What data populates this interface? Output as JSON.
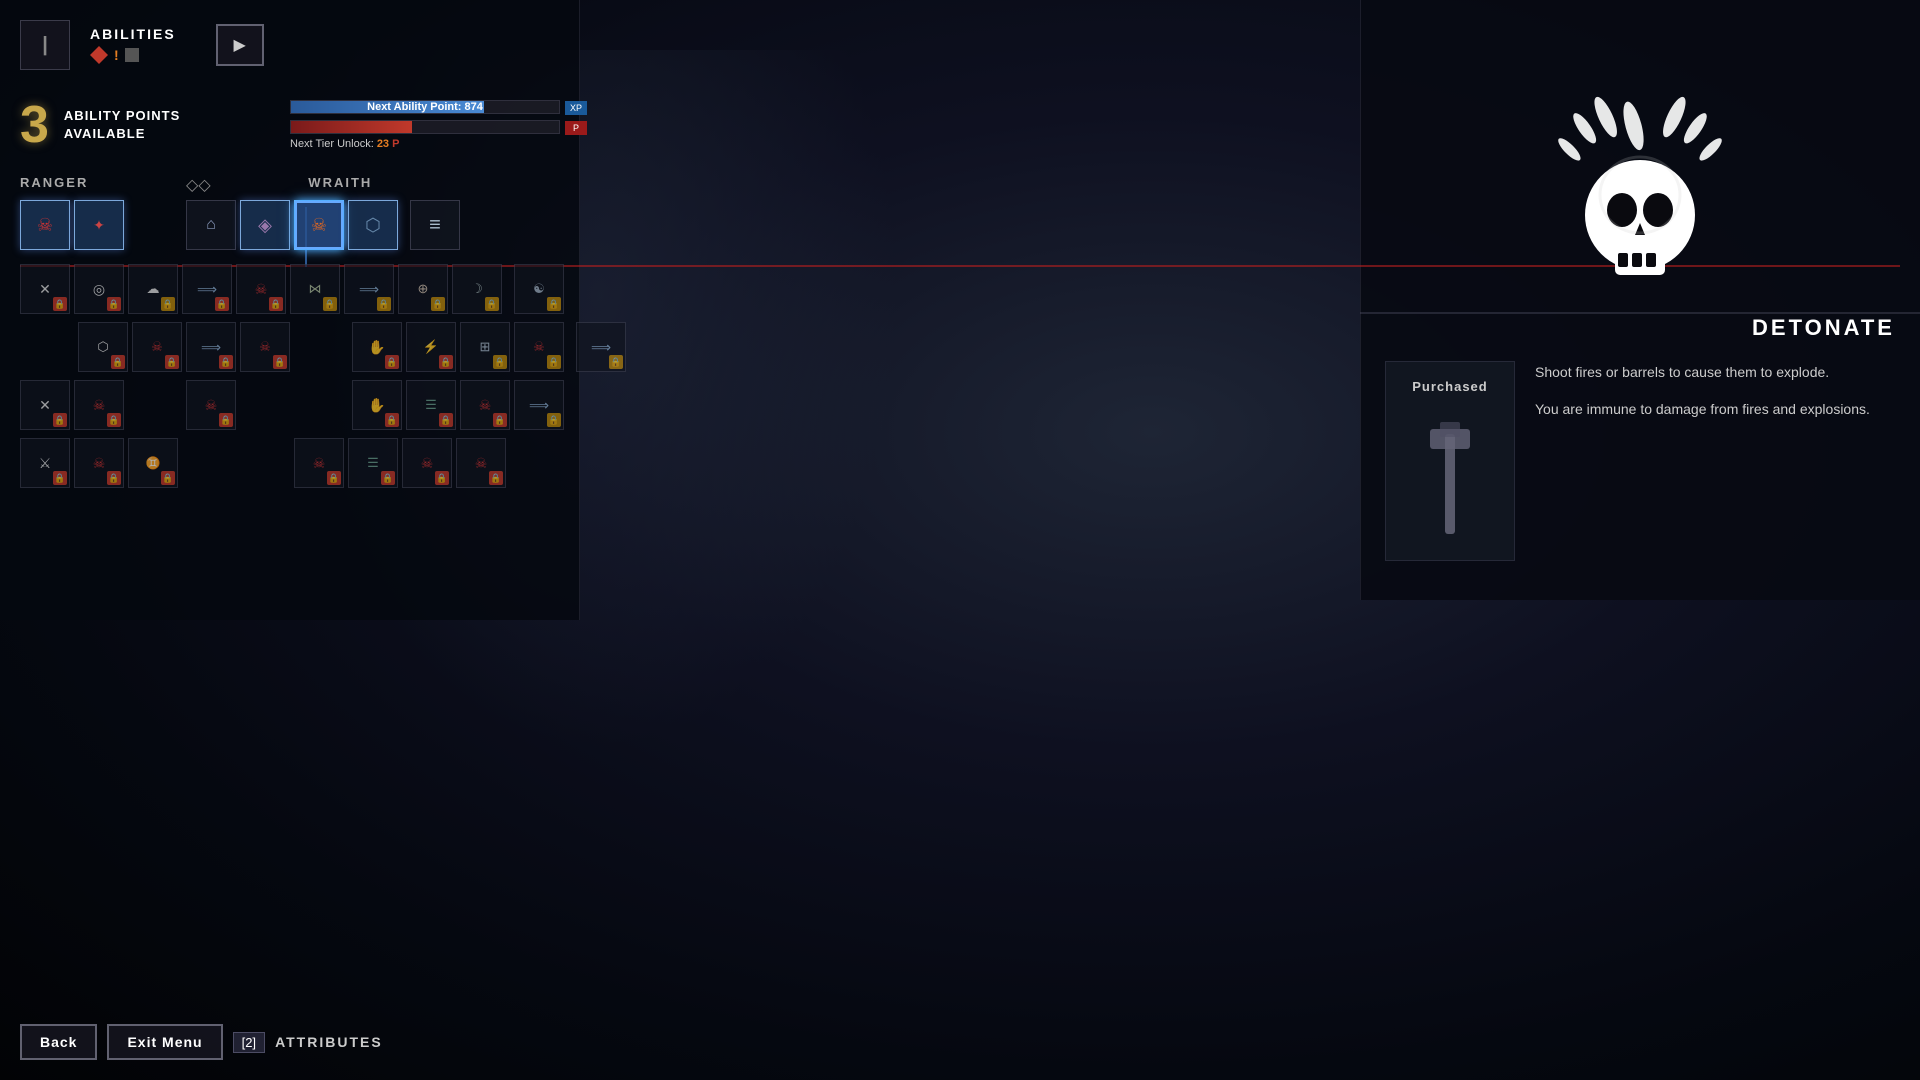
{
  "header": {
    "tab_icon": "|",
    "abilities_label": "ABILITIES",
    "forward_btn": "▶",
    "ability_icons": [
      "◆",
      "!",
      "■"
    ]
  },
  "stats": {
    "ap_number": "3",
    "ap_label": "ABILITY POINTS\nAVAILABLE",
    "xp_bar_label": "Next Ability Point: 874",
    "xp_badge": "XP",
    "tier_label": "Next Tier Unlock: ",
    "tier_number": "23",
    "tier_icon": "P"
  },
  "sections": {
    "ranger_label": "RANGER",
    "wraith_label": "WRAITH",
    "divider": "◇◇"
  },
  "ability_detail": {
    "name": "DETONATE",
    "purchased": "Purchased",
    "description1": "Shoot fires or barrels to cause them to explode.",
    "description2": "You are immune to damage from fires and explosions."
  },
  "bottom": {
    "back_label": "Back",
    "exit_label": "Exit Menu",
    "attr_key": "[2]",
    "attributes_label": "ATTRIBUTES"
  },
  "colors": {
    "accent_blue": "#4a8ad4",
    "accent_red": "#c0392b",
    "accent_gold": "#c8a84b",
    "locked_red": "#c0392b",
    "locked_gold": "#b8860b"
  }
}
